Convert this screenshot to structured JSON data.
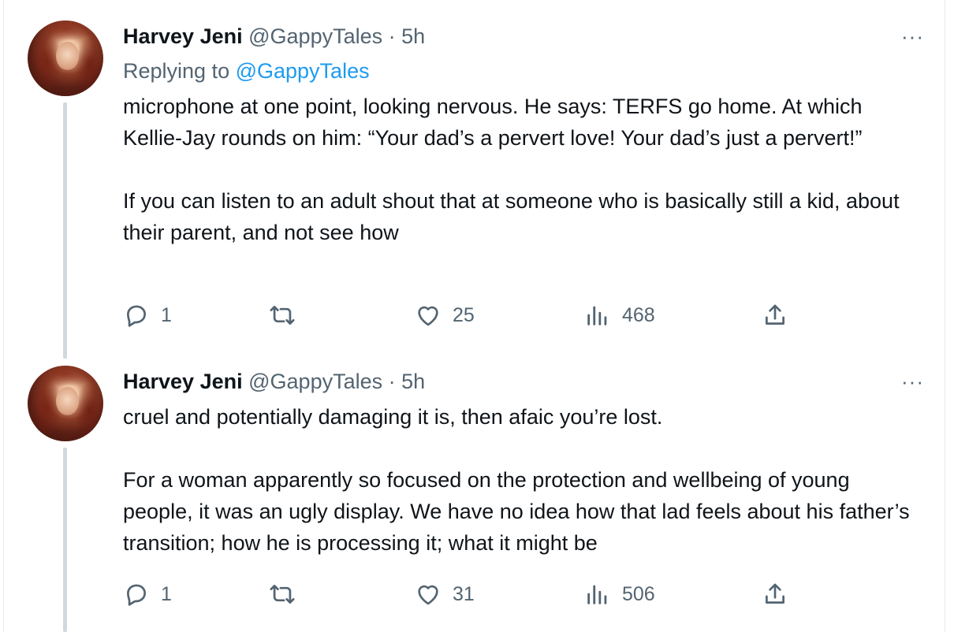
{
  "tweets": [
    {
      "author_name": "Harvey Jeni",
      "author_handle": "@GappyTales",
      "separator": "·",
      "time": "5h",
      "replying_prefix": "Replying to ",
      "replying_handle": "@GappyTales",
      "paragraphs": [
        "microphone at one point, looking nervous. He says: TERFS go home. At which Kellie-Jay rounds on him: “Your dad’s a pervert love! Your dad’s just a pervert!”",
        "If you can listen to an adult shout that at someone who is basically still a kid, about their parent, and not see how"
      ],
      "replies": "1",
      "retweets": "",
      "likes": "25",
      "views": "468"
    },
    {
      "author_name": "Harvey Jeni",
      "author_handle": "@GappyTales",
      "separator": "·",
      "time": "5h",
      "paragraphs": [
        "cruel and potentially damaging it is, then afaic you’re lost.",
        "For a woman apparently so focused on the protection and wellbeing of young people, it was an ugly display. We have no idea how that lad feels about his father’s transition; how he is processing it; what it might be"
      ],
      "replies": "1",
      "retweets": "",
      "likes": "31",
      "views": "506"
    }
  ],
  "more_label": "···",
  "colors": {
    "text": "#0f1419",
    "muted": "#536471",
    "link": "#1d9bf0",
    "thread": "#cfd9de"
  },
  "icons": [
    "reply-icon",
    "retweet-icon",
    "like-icon",
    "views-icon",
    "share-icon",
    "more-icon"
  ]
}
